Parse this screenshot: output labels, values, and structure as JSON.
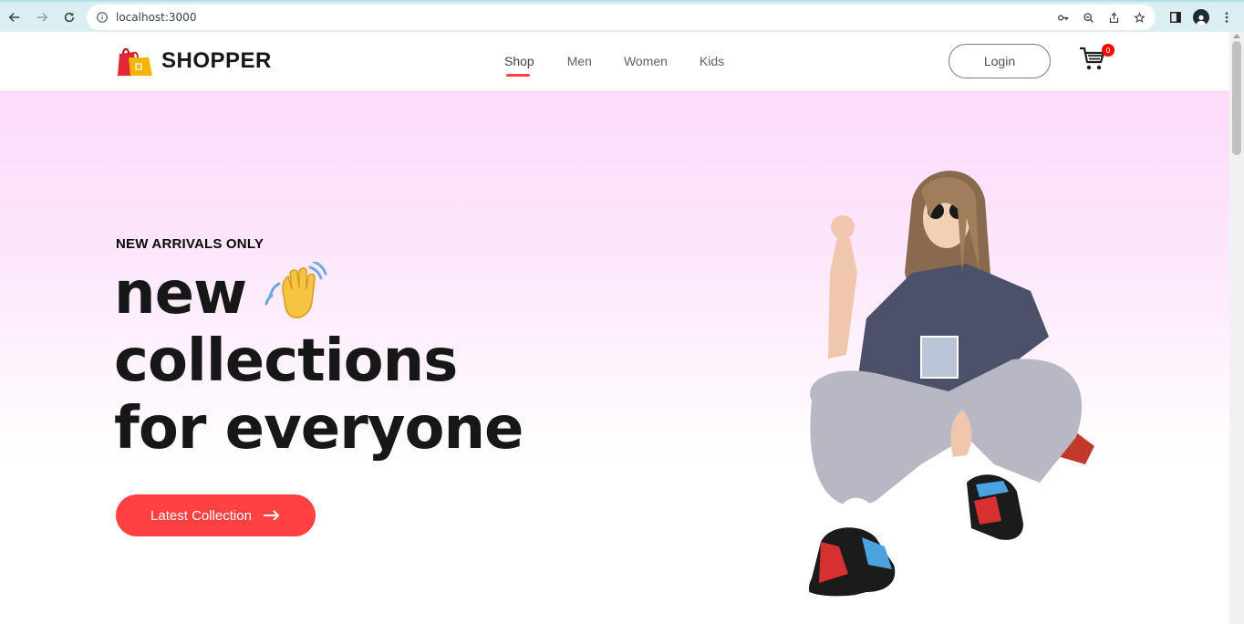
{
  "browser": {
    "url": "localhost:3000",
    "icons": [
      "back-icon",
      "forward-icon",
      "reload-icon",
      "info-icon",
      "key-icon",
      "zoom-icon",
      "share-icon",
      "star-icon",
      "sidepanel-icon",
      "profile-icon",
      "menu-icon"
    ]
  },
  "navbar": {
    "brand": "SHOPPER",
    "menu": [
      {
        "label": "Shop",
        "active": true
      },
      {
        "label": "Men",
        "active": false
      },
      {
        "label": "Women",
        "active": false
      },
      {
        "label": "Kids",
        "active": false
      }
    ],
    "login_label": "Login",
    "cart_count": "0"
  },
  "hero": {
    "eyebrow": "NEW ARRIVALS ONLY",
    "line1": "new",
    "line2": "collections",
    "line3": "for everyone",
    "cta_label": "Latest Collection"
  },
  "colors": {
    "accent": "#ff4141",
    "hero_gradient_top": "#fbdcfb",
    "hero_gradient_bottom": "#ffffff"
  }
}
